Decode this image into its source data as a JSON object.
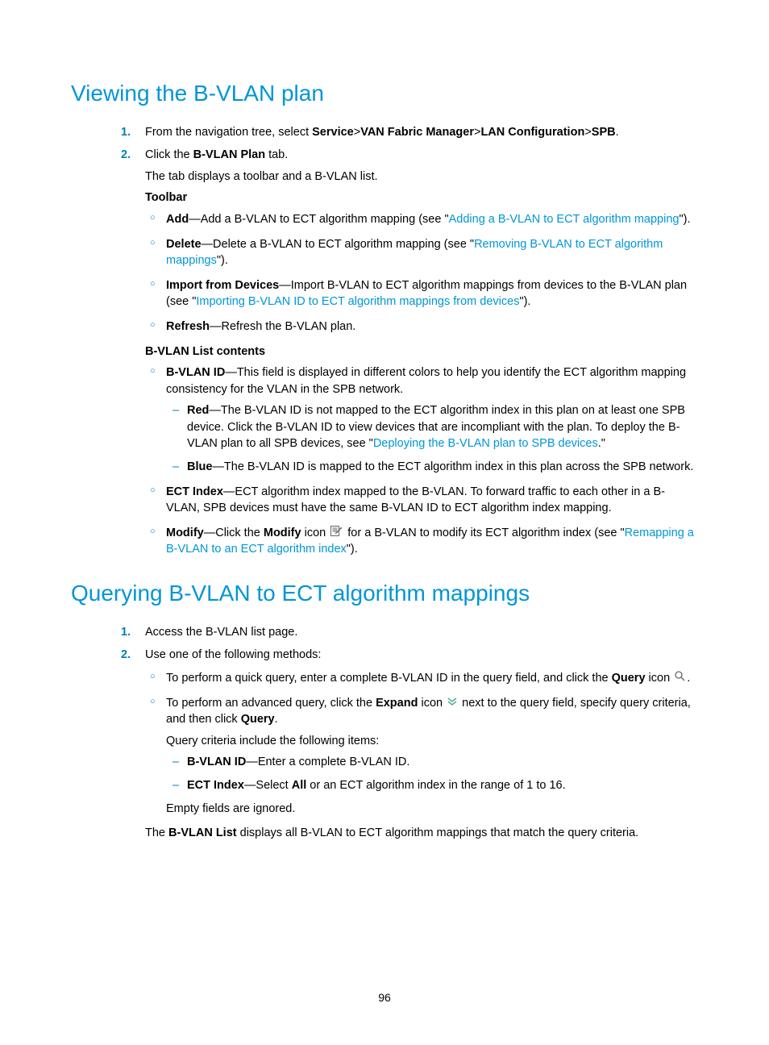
{
  "h1a": "Viewing the B-VLAN plan",
  "s1": {
    "step1_pre": "From the navigation tree, select ",
    "bc": {
      "a": "Service",
      "b": "VAN Fabric Manager",
      "c": "LAN Configuration",
      "d": "SPB"
    },
    "step1_post": ".",
    "step2_pre": "Click the ",
    "step2_bold": "B-VLAN Plan",
    "step2_post": " tab.",
    "tabDisplays": "The tab displays a toolbar and a B-VLAN list.",
    "toolbarLabel": "Toolbar",
    "tool": {
      "add_b": "Add",
      "add_txt": "—Add a B-VLAN to ECT algorithm mapping (see \"",
      "add_link": "Adding a B-VLAN to ECT algorithm mapping",
      "add_end": "\").",
      "del_b": "Delete",
      "del_txt": "—Delete a B-VLAN to ECT algorithm mapping (see \"",
      "del_link": "Removing B-VLAN to ECT algorithm mappings",
      "del_end": "\").",
      "imp_b": "Import from Devices",
      "imp_txt": "—Import B-VLAN to ECT algorithm mappings from devices to the B-VLAN plan (see \"",
      "imp_link": "Importing B-VLAN ID to ECT algorithm mappings from devices",
      "imp_end": "\").",
      "ref_b": "Refresh",
      "ref_txt": "—Refresh the B-VLAN plan."
    },
    "listLabel": "B-VLAN List contents",
    "list": {
      "id_b": "B-VLAN ID",
      "id_txt": "—This field is displayed in different colors to help you identify the ECT algorithm mapping consistency for the VLAN in the SPB network.",
      "red_b": "Red",
      "red_txt": "—The B-VLAN ID is not mapped to the ECT algorithm index in this plan on at least one SPB device. Click the B-VLAN ID to view devices that are incompliant with the plan. To deploy the B-VLAN plan to all SPB devices, see \"",
      "red_link": "Deploying the B-VLAN plan to SPB devices",
      "red_end": ".\"",
      "blue_b": "Blue",
      "blue_txt": "—The B-VLAN ID is mapped to the ECT algorithm index in this plan across the SPB network.",
      "ect_b": "ECT Index",
      "ect_txt": "—ECT algorithm index mapped to the B-VLAN. To forward traffic to each other in a B-VLAN, SPB devices must have the same B-VLAN ID to ECT algorithm index mapping.",
      "mod_b": "Modify",
      "mod_pre": "—Click the ",
      "mod_bold2": "Modify",
      "mod_mid": " icon ",
      "mod_post": " for a B-VLAN to modify its ECT algorithm index (see \"",
      "mod_link": "Remapping a B-VLAN to an ECT algorithm index",
      "mod_end": "\")."
    }
  },
  "h1b": "Querying B-VLAN to ECT algorithm mappings",
  "s2": {
    "step1": "Access the B-VLAN list page.",
    "step2": "Use one of the following methods:",
    "quick_pre": "To perform a quick query, enter a complete B-VLAN ID in the query field, and click the ",
    "quick_bold": "Query",
    "quick_post": " icon ",
    "quick_end": ".",
    "adv_pre": "To perform an advanced query, click the ",
    "adv_bold": "Expand",
    "adv_mid": " icon ",
    "adv_post": " next to the query field, specify query criteria, and then click ",
    "adv_bold2": "Query",
    "adv_end": ".",
    "crit_intro": "Query criteria include the following items:",
    "crit_id_b": "B-VLAN ID",
    "crit_id_txt": "—Enter a complete B-VLAN ID.",
    "crit_ect_b": "ECT Index",
    "crit_ect_pre": "—Select ",
    "crit_ect_bold": "All",
    "crit_ect_post": " or an ECT algorithm index in the range of 1 to 16.",
    "empty": "Empty fields are ignored.",
    "result_pre": "The ",
    "result_bold": "B-VLAN List",
    "result_post": " displays all B-VLAN to ECT algorithm mappings that match the query criteria."
  },
  "pageNum": "96"
}
